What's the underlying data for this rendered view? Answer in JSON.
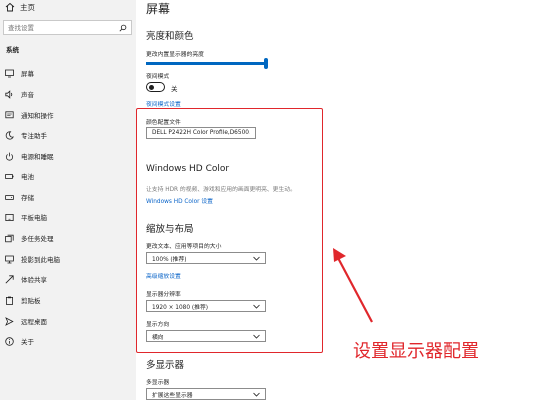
{
  "sidebar": {
    "home_label": "主页",
    "search_placeholder": "查找设置",
    "section_title": "系统",
    "items": [
      {
        "label": "屏幕",
        "icon": "display-icon"
      },
      {
        "label": "声音",
        "icon": "speaker-icon"
      },
      {
        "label": "通知和操作",
        "icon": "notification-icon"
      },
      {
        "label": "专注助手",
        "icon": "moon-icon"
      },
      {
        "label": "电源和睡眠",
        "icon": "power-icon"
      },
      {
        "label": "电池",
        "icon": "battery-icon"
      },
      {
        "label": "存储",
        "icon": "storage-icon"
      },
      {
        "label": "平板电脑",
        "icon": "tablet-icon"
      },
      {
        "label": "多任务处理",
        "icon": "multitask-icon"
      },
      {
        "label": "投影到此电脑",
        "icon": "projector-icon"
      },
      {
        "label": "体验共享",
        "icon": "share-icon"
      },
      {
        "label": "剪贴板",
        "icon": "clipboard-icon"
      },
      {
        "label": "远程桌面",
        "icon": "remote-desktop-icon"
      },
      {
        "label": "关于",
        "icon": "info-icon"
      }
    ]
  },
  "main": {
    "title": "屏幕",
    "brightness": {
      "heading": "亮度和颜色",
      "label": "更改内置显示器的亮度",
      "level": 1.0
    },
    "night_light": {
      "label": "夜间模式",
      "state": "关",
      "settings_link": "夜间模式设置"
    },
    "color_profile": {
      "label": "颜色配置文件",
      "value": "DELL P2422H Color Profile,D6500"
    },
    "hd_color": {
      "heading": "Windows HD Color",
      "description": "让支持 HDR 的视频、游戏和应用的画面更明亮、更生动。",
      "link": "Windows HD Color 设置"
    },
    "scale_layout": {
      "heading": "缩放与布局",
      "scale_label": "更改文本、应用等项目的大小",
      "scale_value": "100% (推荐)",
      "advanced_link": "高级缩放设置",
      "resolution_label": "显示器分辨率",
      "resolution_value": "1920 × 1080 (推荐)",
      "orientation_label": "显示方向",
      "orientation_value": "横向"
    },
    "multi_display": {
      "heading": "多显示器",
      "label": "多显示器",
      "value": "扩展这些显示器"
    }
  },
  "annotation": {
    "text": "设置显示器配置",
    "color": "#e0272c"
  },
  "colors": {
    "accent": "#0067c0",
    "link": "#0a64c8",
    "sidebar_bg": "#f2f2f2"
  }
}
